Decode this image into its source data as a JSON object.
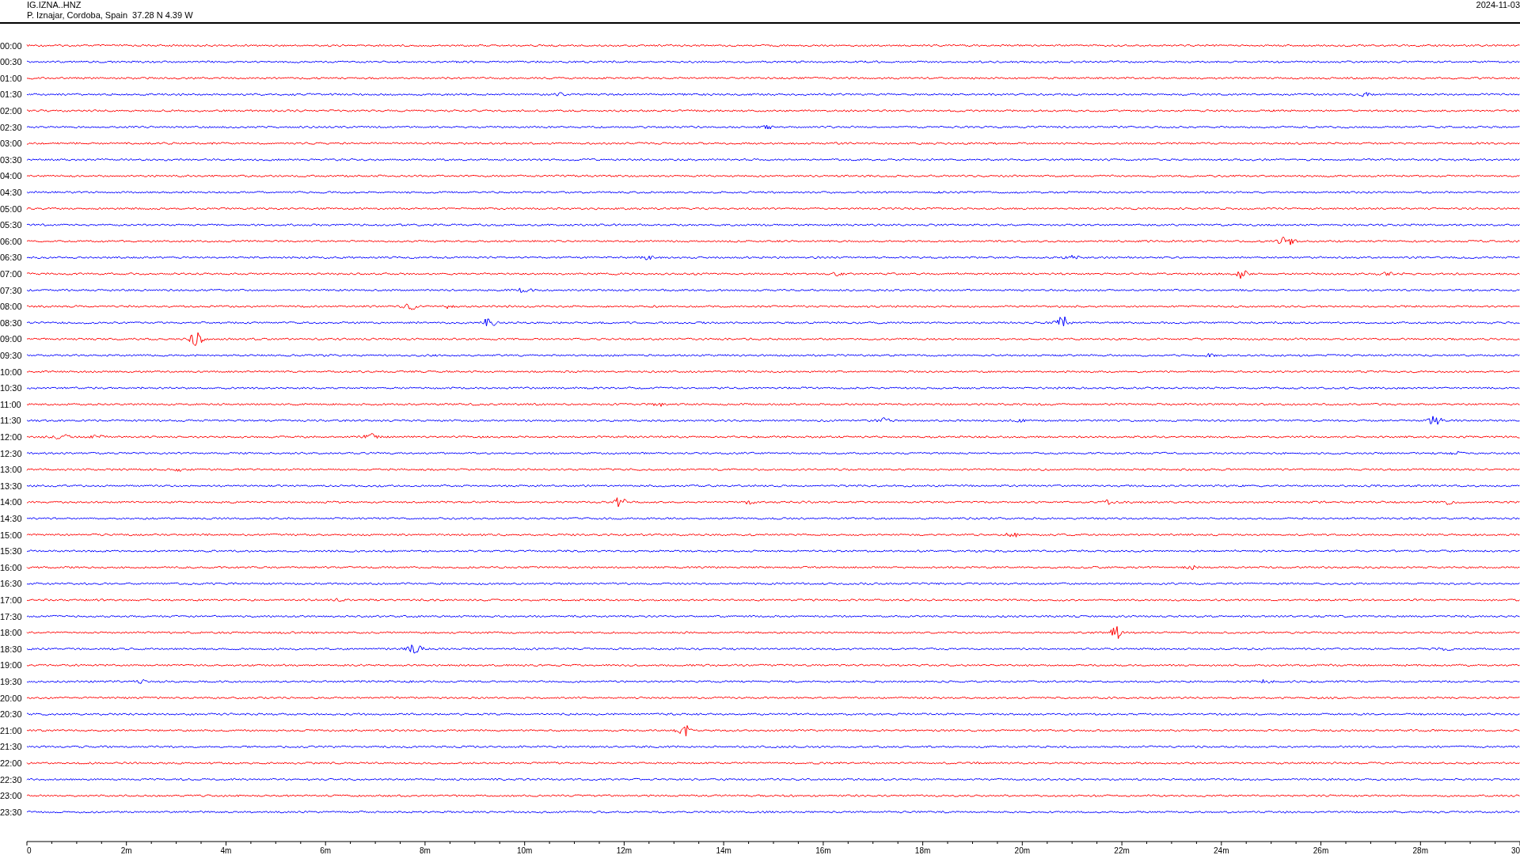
{
  "header": {
    "station": "IG.IZNA..HNZ",
    "location": "P. Iznajar, Cordoba, Spain  37.28 N 4.39 W",
    "date": "2024-11-03"
  },
  "traces": [
    {
      "time": "00:00",
      "color": "#ff0000"
    },
    {
      "time": "00:30",
      "color": "#0000ff"
    },
    {
      "time": "01:00",
      "color": "#ff0000"
    },
    {
      "time": "01:30",
      "color": "#0000ff"
    },
    {
      "time": "02:00",
      "color": "#ff0000"
    },
    {
      "time": "02:30",
      "color": "#0000ff"
    },
    {
      "time": "03:00",
      "color": "#ff0000"
    },
    {
      "time": "03:30",
      "color": "#0000ff"
    },
    {
      "time": "04:00",
      "color": "#ff0000"
    },
    {
      "time": "04:30",
      "color": "#0000ff"
    },
    {
      "time": "05:00",
      "color": "#ff0000"
    },
    {
      "time": "05:30",
      "color": "#0000ff"
    },
    {
      "time": "06:00",
      "color": "#ff0000"
    },
    {
      "time": "06:30",
      "color": "#0000ff"
    },
    {
      "time": "07:00",
      "color": "#ff0000"
    },
    {
      "time": "07:30",
      "color": "#0000ff"
    },
    {
      "time": "08:00",
      "color": "#ff0000"
    },
    {
      "time": "08:30",
      "color": "#0000ff"
    },
    {
      "time": "09:00",
      "color": "#ff0000"
    },
    {
      "time": "09:30",
      "color": "#0000ff"
    },
    {
      "time": "10:00",
      "color": "#ff0000"
    },
    {
      "time": "10:30",
      "color": "#0000ff"
    },
    {
      "time": "11:00",
      "color": "#ff0000"
    },
    {
      "time": "11:30",
      "color": "#0000ff"
    },
    {
      "time": "12:00",
      "color": "#ff0000"
    },
    {
      "time": "12:30",
      "color": "#0000ff"
    },
    {
      "time": "13:00",
      "color": "#ff0000"
    },
    {
      "time": "13:30",
      "color": "#0000ff"
    },
    {
      "time": "14:00",
      "color": "#ff0000"
    },
    {
      "time": "14:30",
      "color": "#0000ff"
    },
    {
      "time": "15:00",
      "color": "#ff0000"
    },
    {
      "time": "15:30",
      "color": "#0000ff"
    },
    {
      "time": "16:00",
      "color": "#ff0000"
    },
    {
      "time": "16:30",
      "color": "#0000ff"
    },
    {
      "time": "17:00",
      "color": "#ff0000"
    },
    {
      "time": "17:30",
      "color": "#0000ff"
    },
    {
      "time": "18:00",
      "color": "#ff0000"
    },
    {
      "time": "18:30",
      "color": "#0000ff"
    },
    {
      "time": "19:00",
      "color": "#ff0000"
    },
    {
      "time": "19:30",
      "color": "#0000ff"
    },
    {
      "time": "20:00",
      "color": "#ff0000"
    },
    {
      "time": "20:30",
      "color": "#0000ff"
    },
    {
      "time": "21:00",
      "color": "#ff0000"
    },
    {
      "time": "21:30",
      "color": "#0000ff"
    },
    {
      "time": "22:00",
      "color": "#ff0000"
    },
    {
      "time": "22:30",
      "color": "#0000ff"
    },
    {
      "time": "23:00",
      "color": "#ff0000"
    },
    {
      "time": "23:30",
      "color": "#0000ff"
    }
  ],
  "x_axis": {
    "labels": [
      "0",
      "2m",
      "4m",
      "6m",
      "8m",
      "10m",
      "12m",
      "14m",
      "16m",
      "18m",
      "20m",
      "22m",
      "24m",
      "26m",
      "28m",
      "30"
    ]
  }
}
